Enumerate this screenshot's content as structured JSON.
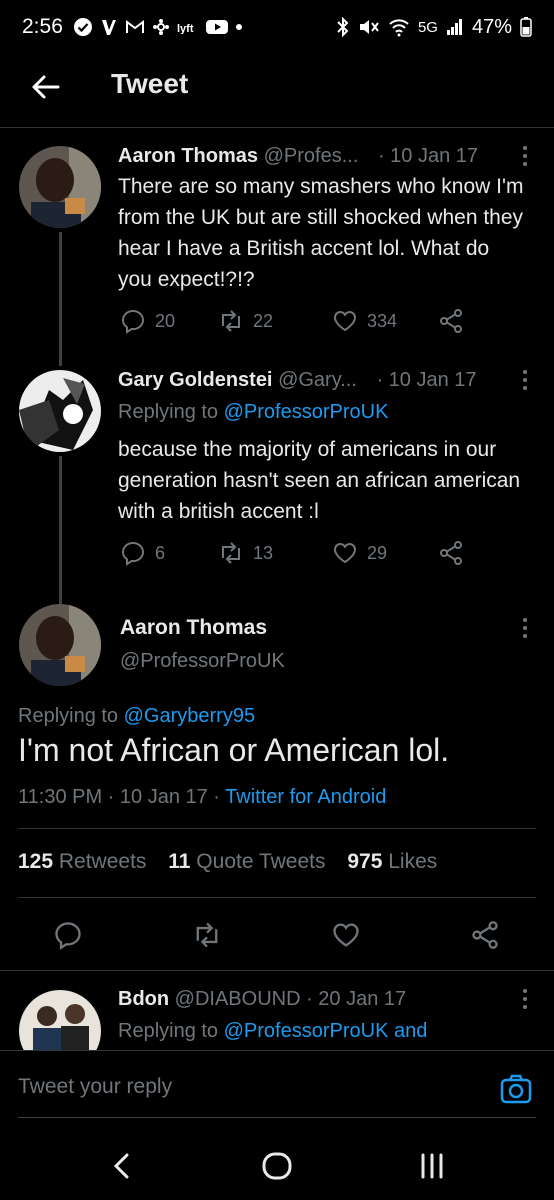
{
  "status_bar": {
    "time": "2:56",
    "network": "5G",
    "battery": "47%"
  },
  "header": {
    "title": "Tweet"
  },
  "thread": [
    {
      "name": "Aaron Thomas",
      "handle": "@Profes...",
      "date": "· 10 Jan 17",
      "text": "There are so many smashers who know I'm from the UK but are still shocked when they hear I have a British accent lol. What do you expect!?!?",
      "replies": "20",
      "retweets": "22",
      "likes": "334"
    },
    {
      "name": "Gary Goldenstei",
      "handle": "@Gary...",
      "date": "· 10 Jan 17",
      "reply_prefix": "Replying to ",
      "reply_to": "@ProfessorProUK",
      "text": "because the majority of americans in our generation hasn't seen an african american with a british accent :l",
      "replies": "6",
      "retweets": "13",
      "likes": "29"
    }
  ],
  "main_tweet": {
    "name": "Aaron Thomas",
    "handle": "@ProfessorProUK",
    "reply_prefix": "Replying to ",
    "reply_to": "@Garyberry95",
    "text": "I'm not African or American lol.",
    "time": "11:30 PM · 10 Jan 17 · ",
    "source": "Twitter for Android",
    "retweets_count": "125",
    "retweets_label": " Retweets",
    "quotes_count": "11",
    "quotes_label": " Quote Tweets",
    "likes_count": "975",
    "likes_label": " Likes"
  },
  "reply_tweet": {
    "name": "Bdon",
    "handle": "@DIABOUND",
    "date": "· 20 Jan 17",
    "reply_prefix": "Replying to ",
    "reply_to": "@ProfessorProUK and"
  },
  "composer": {
    "placeholder": "Tweet your reply"
  },
  "colors": {
    "accent": "#1d9bf0",
    "muted": "#71767b",
    "text": "#e7e9ea",
    "background": "#000000"
  }
}
